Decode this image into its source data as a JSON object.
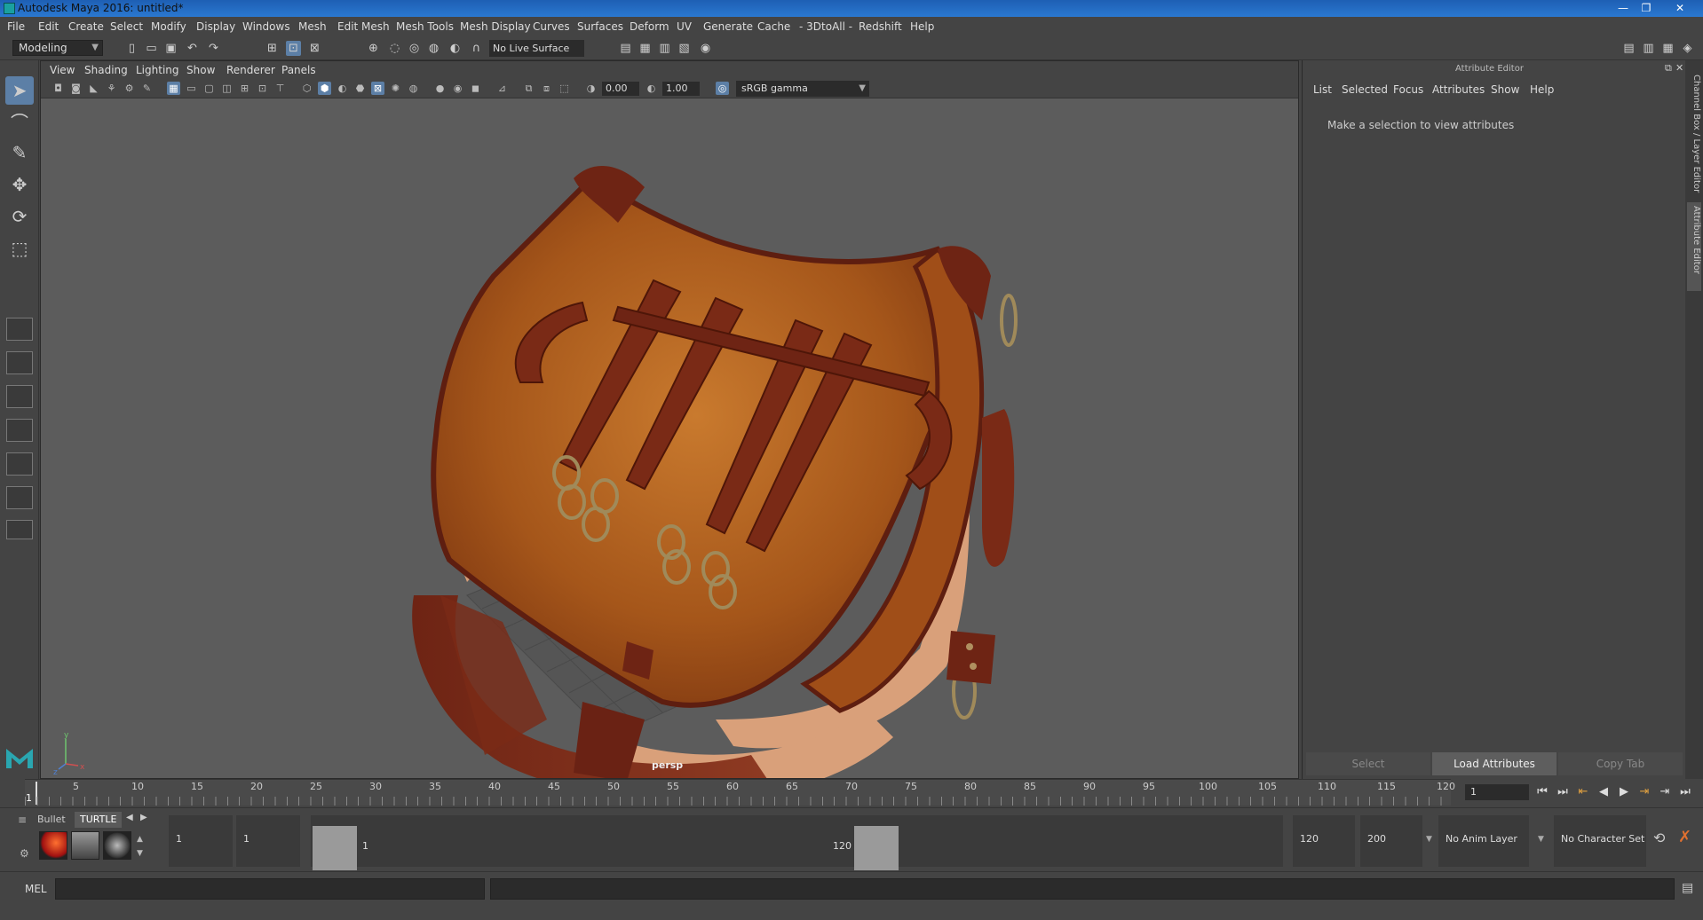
{
  "window": {
    "title": "Autodesk Maya 2016: untitled*",
    "controls": [
      "—",
      "❐",
      "✕"
    ]
  },
  "menubar": {
    "items": [
      "File",
      "Edit",
      "Create",
      "Select",
      "Modify",
      "Display",
      "Windows",
      "Mesh",
      "Edit Mesh",
      "Mesh Tools",
      "Mesh Display",
      "Curves",
      "Surfaces",
      "Deform",
      "UV",
      "Generate",
      "Cache",
      "- 3DtoAll -",
      "Redshift",
      "Help"
    ]
  },
  "status": {
    "mode": "Modeling",
    "live_surface": "No Live Surface"
  },
  "viewport": {
    "menus": [
      "View",
      "Shading",
      "Lighting",
      "Show",
      "Renderer",
      "Panels"
    ],
    "exposure": "0.00",
    "gamma": "1.00",
    "color_space": "sRGB gamma",
    "camera": "persp"
  },
  "attribute_editor": {
    "title": "Attribute Editor",
    "menus": [
      "List",
      "Selected",
      "Focus",
      "Attributes",
      "Show",
      "Help"
    ],
    "message": "Make a selection to view attributes",
    "buttons": {
      "select": "Select",
      "load": "Load Attributes",
      "copy": "Copy Tab"
    }
  },
  "side_tabs": [
    "Channel Box / Layer Editor",
    "Attribute Editor"
  ],
  "timeline": {
    "ticks": [
      "1",
      "5",
      "10",
      "15",
      "20",
      "25",
      "30",
      "35",
      "40",
      "45",
      "50",
      "55",
      "60",
      "65",
      "70",
      "75",
      "80",
      "85",
      "90",
      "95",
      "100",
      "105",
      "110",
      "115",
      "120"
    ],
    "current_frame": "1"
  },
  "shelf": {
    "tabs": [
      "Bullet",
      "TURTLE"
    ]
  },
  "range": {
    "start": "1",
    "playback_start": "1",
    "slider_start": "1",
    "slider_end": "120",
    "playback_end": "120",
    "end": "200",
    "anim_layer": "No Anim Layer",
    "character_set": "No Character Set"
  },
  "command": {
    "label": "MEL"
  },
  "colors": {
    "accent": "#5c7fa6",
    "panel": "#444444",
    "viewport_bg": "#5c5c5c",
    "leather_main": "#b3621e",
    "leather_dark": "#6e2414",
    "strap_light": "#d9a07a"
  }
}
